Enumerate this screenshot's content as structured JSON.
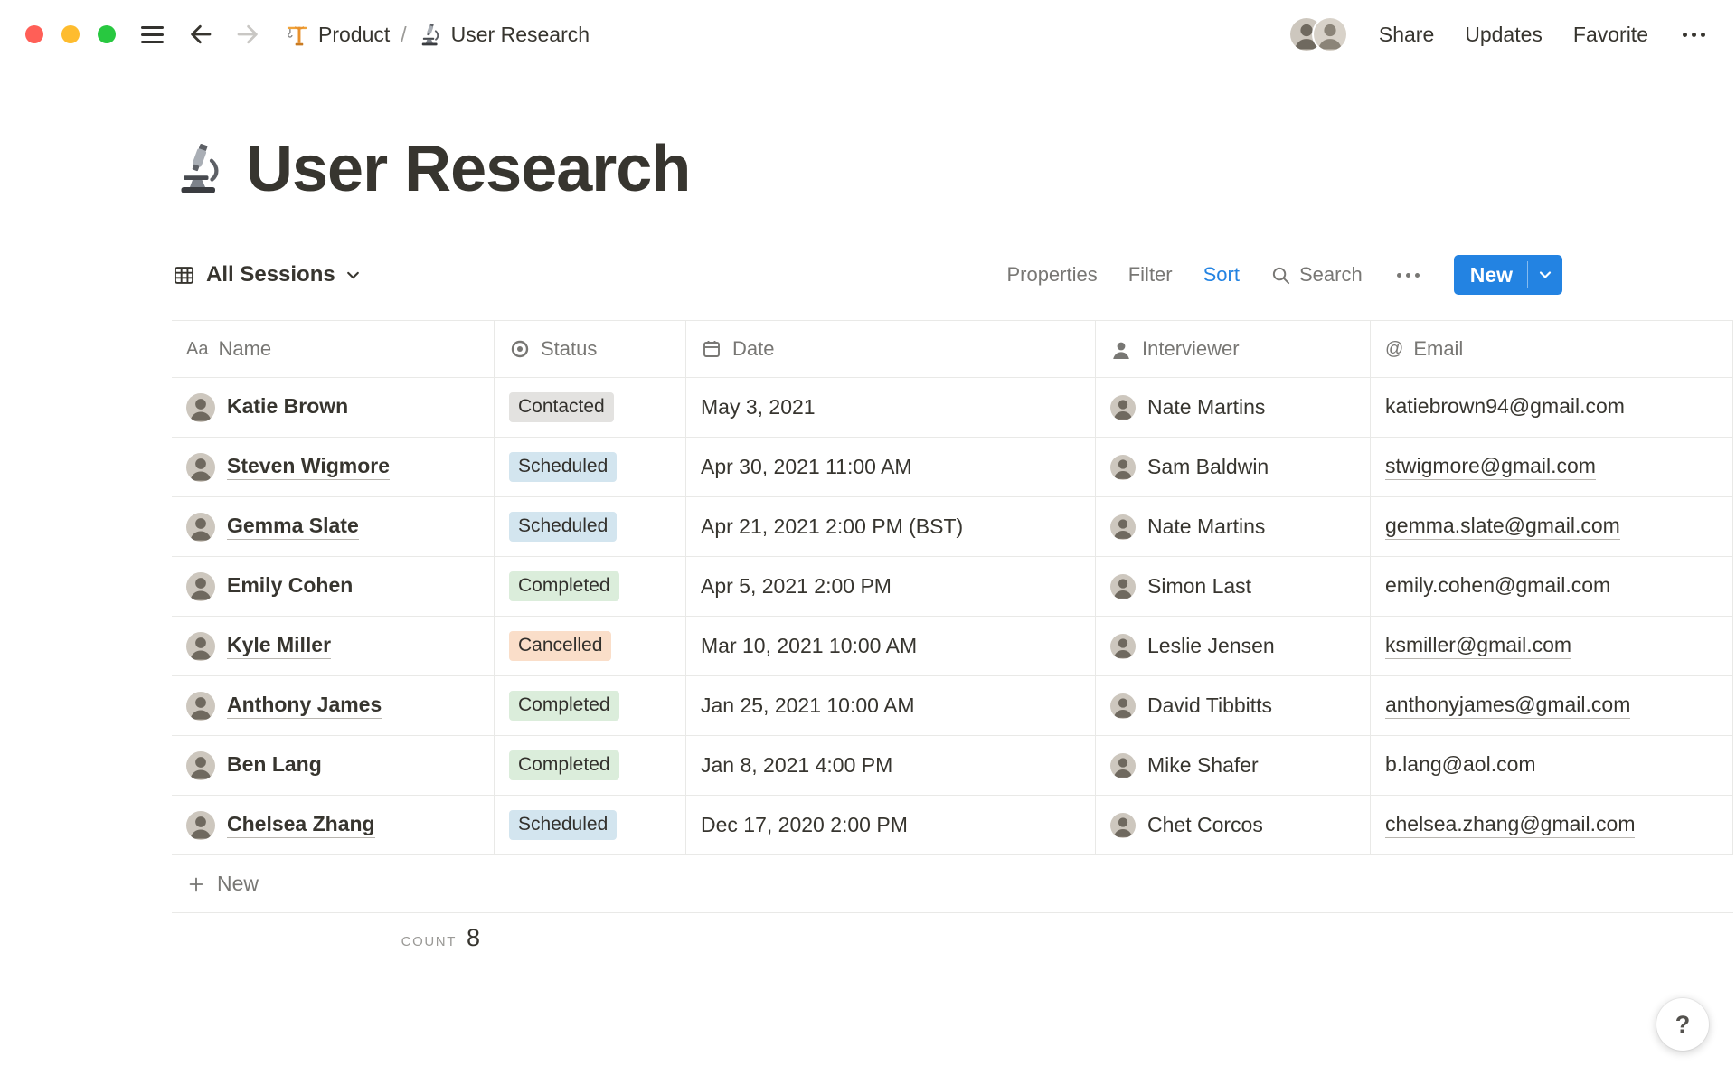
{
  "topbar": {
    "separator": "/",
    "breadcrumb": [
      {
        "icon": "crane-icon",
        "label": "Product"
      },
      {
        "icon": "microscope-icon",
        "label": "User Research"
      }
    ],
    "actions": {
      "share": "Share",
      "updates": "Updates",
      "favorite": "Favorite"
    }
  },
  "page": {
    "icon": "microscope-icon",
    "title": "User Research"
  },
  "toolbar": {
    "view_label": "All Sessions",
    "properties": "Properties",
    "filter": "Filter",
    "sort": "Sort",
    "search_label": "Search",
    "new_label": "New"
  },
  "table": {
    "columns": [
      {
        "id": "name",
        "label": "Name",
        "icon": "text-icon",
        "icon_text": "Aa"
      },
      {
        "id": "status",
        "label": "Status",
        "icon": "status-icon",
        "icon_text": ""
      },
      {
        "id": "date",
        "label": "Date",
        "icon": "calendar-icon",
        "icon_text": ""
      },
      {
        "id": "interviewer",
        "label": "Interviewer",
        "icon": "person-icon",
        "icon_text": ""
      },
      {
        "id": "email",
        "label": "Email",
        "icon": "at-icon",
        "icon_text": "@"
      }
    ],
    "rows": [
      {
        "name": "Katie Brown",
        "status": "Contacted",
        "status_color": "gray",
        "date": "May 3, 2021",
        "interviewer": "Nate Martins",
        "email": "katiebrown94@gmail.com"
      },
      {
        "name": "Steven Wigmore",
        "status": "Scheduled",
        "status_color": "blue",
        "date": "Apr 30, 2021 11:00 AM",
        "interviewer": "Sam Baldwin",
        "email": "stwigmore@gmail.com"
      },
      {
        "name": "Gemma Slate",
        "status": "Scheduled",
        "status_color": "blue",
        "date": "Apr 21, 2021 2:00 PM (BST)",
        "interviewer": "Nate Martins",
        "email": "gemma.slate@gmail.com"
      },
      {
        "name": "Emily Cohen",
        "status": "Completed",
        "status_color": "green",
        "date": "Apr 5, 2021 2:00 PM",
        "interviewer": "Simon Last",
        "email": "emily.cohen@gmail.com"
      },
      {
        "name": "Kyle Miller",
        "status": "Cancelled",
        "status_color": "orange",
        "date": "Mar 10, 2021 10:00 AM",
        "interviewer": "Leslie Jensen",
        "email": "ksmiller@gmail.com"
      },
      {
        "name": "Anthony James",
        "status": "Completed",
        "status_color": "green",
        "date": "Jan 25, 2021 10:00 AM",
        "interviewer": "David Tibbitts",
        "email": "anthonyjames@gmail.com"
      },
      {
        "name": "Ben Lang",
        "status": "Completed",
        "status_color": "green",
        "date": "Jan 8, 2021 4:00 PM",
        "interviewer": "Mike Shafer",
        "email": "b.lang@aol.com"
      },
      {
        "name": "Chelsea Zhang",
        "status": "Scheduled",
        "status_color": "blue",
        "date": "Dec 17, 2020 2:00 PM",
        "interviewer": "Chet Corcos",
        "email": "chelsea.zhang@gmail.com"
      }
    ],
    "new_row_label": "New",
    "footer": {
      "count_label": "COUNT",
      "count_value": "8"
    }
  },
  "help": {
    "label": "?"
  },
  "colors": {
    "accent": "#2383e2",
    "badge_gray": "#e3e2e0",
    "badge_blue": "#d3e5ef",
    "badge_green": "#dbeddb",
    "badge_orange": "#fadec9",
    "text": "#37352f",
    "muted_text": "#787774",
    "border": "#e9e9e7"
  }
}
